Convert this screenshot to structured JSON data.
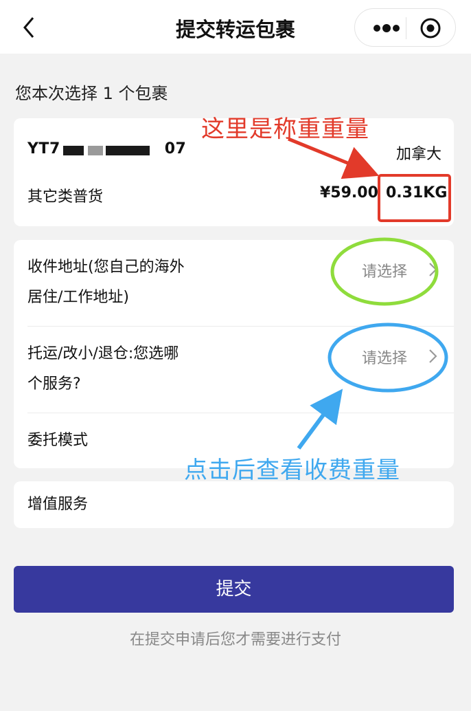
{
  "nav": {
    "title": "提交转运包裹"
  },
  "section_heading": "您本次选择 1 个包裹",
  "package": {
    "id_prefix": "YT7",
    "id_suffix": "07",
    "destination": "加拿大",
    "cargo_type": "其它类普货",
    "price": "¥59.00",
    "weight": "0.31KG"
  },
  "options": [
    {
      "label_line1": "收件地址(您自己的海外",
      "label_line2": "居住/工作地址)",
      "value": "请选择"
    },
    {
      "label_line1": "托运/改小/退仓:您选哪",
      "label_line2": "个服务?",
      "value": "请选择"
    },
    {
      "label_line1": "委托模式",
      "label_line2": "",
      "value": ""
    }
  ],
  "value_added": {
    "label": "增值服务"
  },
  "submit": {
    "label": "提交"
  },
  "hint": "在提交申请后您才需要进行支付",
  "annotations": {
    "red_text": "这里是称重重量",
    "blue_text": "点击后查看收费重量",
    "red_color": "#e23a2a",
    "blue_color": "#3fa8ef",
    "green_color": "#8fdc3c"
  },
  "icons": [
    "back-arrow-icon",
    "more-dots-icon",
    "target-icon",
    "chevron-right-icon"
  ]
}
